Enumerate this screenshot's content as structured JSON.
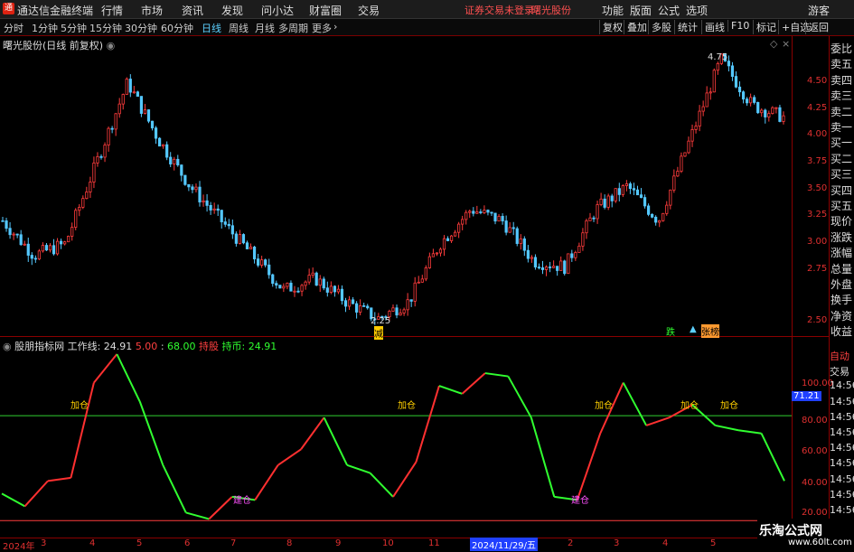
{
  "menubar": {
    "title": "通达信金融终端",
    "items": [
      "行情",
      "市场",
      "资讯",
      "发现",
      "问小达",
      "财富圈",
      "交易"
    ],
    "notice": "证券交易未登录",
    "stock": "曙光股份",
    "right_items": [
      "功能",
      "版面",
      "公式",
      "选项",
      "游客"
    ]
  },
  "periods": [
    "分时",
    "1分钟",
    "5分钟",
    "15分钟",
    "30分钟",
    "60分钟",
    "日线",
    "周线",
    "月线",
    "多周期",
    "更多"
  ],
  "active_period": "日线",
  "toolbar_right": [
    "复权",
    "叠加",
    "多股",
    "统计",
    "画线",
    "F10",
    "标记",
    "+自选",
    "返回"
  ],
  "main_panel": {
    "label": "曙光股份(日线 前复权)",
    "high_label": "4.75",
    "low_label": "2.25",
    "y_ticks": [
      "4.50",
      "4.25",
      "4.00",
      "3.75",
      "3.50",
      "3.25",
      "3.00",
      "2.75",
      "2.50"
    ],
    "marker_tags": [
      "减",
      "跌",
      "张榜"
    ]
  },
  "indicator": {
    "name": "股朋指标网",
    "line_label": "工作线: 24.91",
    "v1": "5.00",
    "v2": "68.00",
    "hold": "持股",
    "coin": "持币: 24.91",
    "current": "71.21",
    "y_ticks": [
      "100.00",
      "80.00",
      "60.00",
      "40.00",
      "20.00"
    ],
    "buy_tags": [
      "加仓",
      "加仓",
      "加仓",
      "加仓",
      "加仓"
    ],
    "build_tags": [
      "建仓",
      "建仓"
    ]
  },
  "chart_data": {
    "type": "line",
    "title": "",
    "xlabel": "",
    "ylabel": "",
    "x": [
      "2024年",
      "3",
      "4",
      "5",
      "6",
      "7",
      "8",
      "9",
      "10",
      "11",
      "2024/11/29/五",
      "2",
      "3",
      "4",
      "5"
    ],
    "ylim": [
      2.2,
      4.8
    ],
    "series": [
      {
        "values": [
          3.2,
          2.9,
          3.0,
          3.7,
          4.4,
          3.9,
          3.5,
          3.2,
          2.9,
          2.6,
          2.7,
          2.5,
          2.35,
          2.5,
          3.0,
          3.3,
          3.2,
          2.85,
          2.8,
          3.3,
          3.5,
          3.2,
          3.9,
          4.6,
          4.2,
          4.1
        ]
      }
    ]
  },
  "ind_data": {
    "ylim": [
      0,
      110
    ],
    "upper_line": 71.2,
    "lower_line": 5,
    "values": [
      22,
      14,
      30,
      32,
      92,
      110,
      80,
      40,
      10,
      6,
      20,
      18,
      40,
      50,
      70,
      40,
      35,
      20,
      42,
      90,
      85,
      98,
      96,
      70,
      20,
      18,
      60,
      92,
      65,
      70,
      78,
      65,
      62,
      60,
      30
    ]
  },
  "sidelist": [
    "委比",
    "卖五",
    "卖四",
    "卖三",
    "卖二",
    "卖一",
    "买一",
    "买二",
    "买三",
    "买四",
    "买五",
    "现价",
    "涨跌",
    "涨幅",
    "总量",
    "外盘",
    "换手",
    "净资",
    "收益"
  ],
  "ind_side": [
    "自动",
    "交易",
    "14:56",
    "14:56",
    "14:56",
    "14:56",
    "14:56",
    "14:56",
    "14:56",
    "14:56",
    "14:56",
    "14:56"
  ],
  "watermark": {
    "line1": "乐淘公式网",
    "line2": "www.60lt.com"
  }
}
